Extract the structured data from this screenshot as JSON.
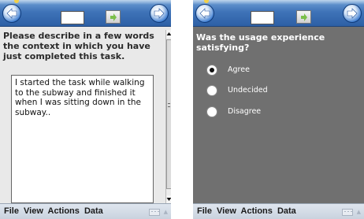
{
  "left_screen": {
    "question": "Please describe in a few words the context in which you have just completed this task.",
    "answer": "I started the task while walking to the subway and finished it when I was sitting down in the subway..",
    "menu": {
      "file": "File",
      "view": "View",
      "actions": "Actions",
      "data": "Data"
    }
  },
  "right_screen": {
    "question": "Was the usage experience satisfying?",
    "options": [
      {
        "label": "Agree",
        "selected": true
      },
      {
        "label": "Undecided",
        "selected": false
      },
      {
        "label": "Disagree",
        "selected": false
      }
    ],
    "menu": {
      "file": "File",
      "view": "View",
      "actions": "Actions",
      "data": "Data"
    }
  },
  "colors": {
    "titlebar": "#3f73b8",
    "left_background": "#e9e9e9",
    "right_background": "#707070"
  },
  "icons": [
    "back-arrow-icon",
    "forward-arrow-icon",
    "go-arrow-icon",
    "keyboard-icon"
  ]
}
